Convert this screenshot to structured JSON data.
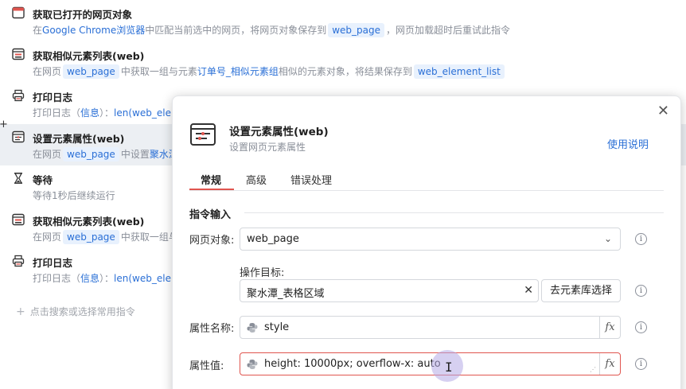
{
  "commands": [
    {
      "icon": "browser-window-icon",
      "title": "获取已打开的网页对象",
      "desc_parts": [
        {
          "t": "在",
          "k": "text"
        },
        {
          "t": "Google Chrome浏览器",
          "k": "link"
        },
        {
          "t": "中匹配当前选中的网页，将网页对象保存到",
          "k": "text"
        },
        {
          "t": "web_page",
          "k": "chip"
        },
        {
          "t": "，网页加载超时后重试此指令",
          "k": "text"
        }
      ]
    },
    {
      "icon": "element-list-icon",
      "title": "获取相似元素列表(web)",
      "desc_parts": [
        {
          "t": "在网页",
          "k": "text"
        },
        {
          "t": "web_page",
          "k": "chip"
        },
        {
          "t": "中获取一组与元素",
          "k": "text"
        },
        {
          "t": "订单号_相似元素组",
          "k": "link"
        },
        {
          "t": "相似的元素对象，将结果保存到",
          "k": "text"
        },
        {
          "t": "web_element_list",
          "k": "chip"
        }
      ]
    },
    {
      "icon": "printer-icon",
      "title": "打印日志",
      "desc_parts": [
        {
          "t": "打印日志（",
          "k": "text"
        },
        {
          "t": "信息",
          "k": "link"
        },
        {
          "t": "）：",
          "k": "text"
        },
        {
          "t": "len(web_ele",
          "k": "link"
        }
      ]
    },
    {
      "icon": "set-attribute-icon",
      "title": "设置元素属性(web)",
      "selected": true,
      "desc_parts": [
        {
          "t": "在网页",
          "k": "text"
        },
        {
          "t": "web_page",
          "k": "chip"
        },
        {
          "t": "中设置",
          "k": "text"
        },
        {
          "t": "聚水潭",
          "k": "link"
        }
      ]
    },
    {
      "icon": "hourglass-icon",
      "title": "等待",
      "desc_parts": [
        {
          "t": "等待1秒后继续运行",
          "k": "text"
        }
      ]
    },
    {
      "icon": "element-list-icon",
      "title": "获取相似元素列表(web)",
      "desc_parts": [
        {
          "t": "在网页",
          "k": "text"
        },
        {
          "t": "web_page",
          "k": "chip"
        },
        {
          "t": "中获取一组与",
          "k": "text"
        }
      ]
    },
    {
      "icon": "printer-icon",
      "title": "打印日志",
      "desc_parts": [
        {
          "t": "打印日志（",
          "k": "text"
        },
        {
          "t": "信息",
          "k": "link"
        },
        {
          "t": "）：",
          "k": "text"
        },
        {
          "t": "len(web_ele",
          "k": "link"
        }
      ]
    }
  ],
  "add_command": "点击搜索或选择常用指令",
  "dialog": {
    "title": "设置元素属性(web)",
    "subtitle": "设置网页元素属性",
    "help": "使用说明",
    "tabs": [
      "常规",
      "高级",
      "错误处理"
    ],
    "active_tab": "常规",
    "section": "指令输入",
    "fields": {
      "page_object": {
        "label": "网页对象:",
        "value": "web_page"
      },
      "target": {
        "label": "操作目标:",
        "value": "聚水潭_表格区域",
        "button": "去元素库选择"
      },
      "attr_name": {
        "label": "属性名称:",
        "value": "style"
      },
      "attr_value": {
        "label": "属性值:",
        "value": "height: 10000px; overflow-x: auto"
      }
    },
    "fx": "fx"
  },
  "colors": {
    "accent_blue": "#2a6fd6",
    "accent_red": "#e0554f",
    "selected_row": "#eceff3"
  }
}
